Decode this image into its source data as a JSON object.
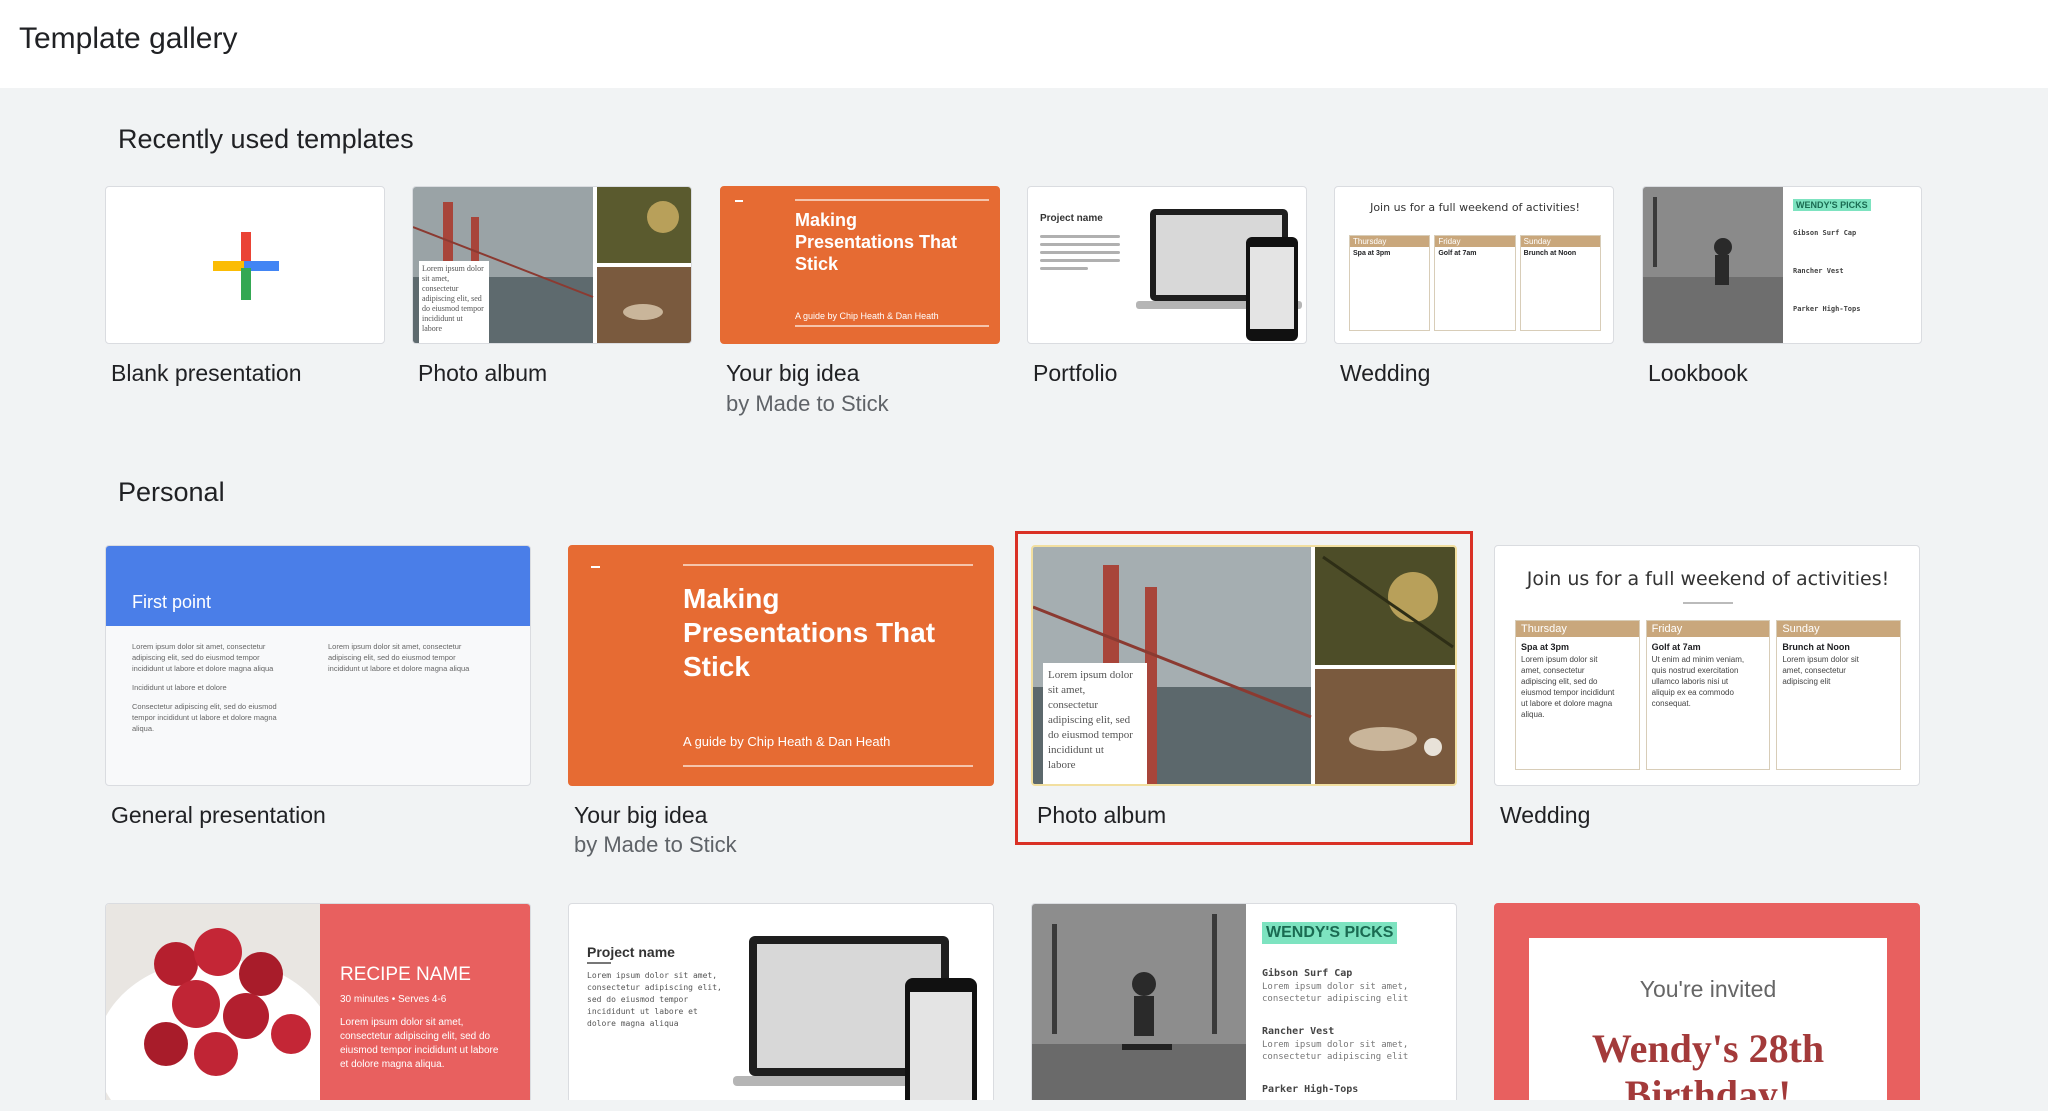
{
  "header": {
    "title": "Template gallery"
  },
  "sections": {
    "recent": {
      "title": "Recently used templates",
      "items": [
        {
          "name": "Blank presentation"
        },
        {
          "name": "Photo album",
          "caption_lines": [
            "Lorem ipsum dolor",
            "sit amet,",
            "consectetur",
            "adipiscing elit, sed",
            "do eiusmod tempor",
            "incididunt ut",
            "labore"
          ]
        },
        {
          "name": "Your big idea",
          "author": "by Made to Stick",
          "heading_lines": [
            "Making",
            "Presentations That",
            "Stick"
          ],
          "tagline": "A guide by Chip Heath & Dan Heath"
        },
        {
          "name": "Portfolio",
          "project": "Project name"
        },
        {
          "name": "Wedding",
          "headline": "Join us for a full weekend of activities!",
          "days": [
            "Thursday",
            "Friday",
            "Sunday"
          ],
          "events": [
            "Spa at 3pm",
            "Golf at 7am",
            "Brunch at Noon"
          ]
        },
        {
          "name": "Lookbook",
          "brand": "WENDY'S PICKS",
          "products": [
            "Gibson Surf Cap",
            "Rancher Vest",
            "Parker High-Tops"
          ]
        }
      ]
    },
    "personal": {
      "title": "Personal",
      "items": [
        {
          "name": "General presentation",
          "slide_title": "First point",
          "left_text": [
            "Lorem ipsum dolor sit amet, consectetur",
            "adipiscing elit, sed do eiusmod tempor",
            "incididunt ut labore et dolore magna aliqua",
            "Incididunt ut labore et dolore",
            "Consectetur adipiscing elit, sed do eiusmod",
            "tempor incididunt ut labore et dolore magna",
            "aliqua."
          ],
          "right_text": [
            "Lorem ipsum dolor sit amet, consectetur",
            "adipiscing elit, sed do eiusmod tempor",
            "incididunt ut labore et dolore magna aliqua"
          ]
        },
        {
          "name": "Your big idea",
          "author": "by Made to Stick",
          "heading_lines": [
            "Making",
            "Presentations That",
            "Stick"
          ],
          "tagline": "A guide by Chip Heath & Dan Heath"
        },
        {
          "name": "Photo album",
          "caption_lines": [
            "Lorem ipsum dolor",
            "sit amet,",
            "consectetur",
            "adipiscing elit, sed",
            "do eiusmod tempor",
            "incididunt ut",
            "labore"
          ]
        },
        {
          "name": "Wedding",
          "headline": "Join us for a full weekend of activities!",
          "days": [
            "Thursday",
            "Friday",
            "Sunday"
          ],
          "events": [
            "Spa at 3pm",
            "Golf at 7am",
            "Brunch at Noon"
          ],
          "day_text": [
            [
              "Lorem ipsum dolor sit",
              "amet, consectetur",
              "adipiscing elit, sed do",
              "eiusmod tempor incididunt",
              "ut labore et dolore magna",
              "aliqua."
            ],
            [
              "Ut enim ad minim veniam,",
              "quis nostrud exercitation",
              "ullamco laboris nisi ut",
              "aliquip ex ea commodo",
              "consequat."
            ],
            [
              "Lorem ipsum dolor sit",
              "amet, consectetur",
              "adipiscing elit"
            ]
          ]
        }
      ]
    },
    "more": {
      "items": [
        {
          "title": "RECIPE NAME",
          "meta": "30 minutes • Serves 4-6",
          "text": [
            "Lorem ipsum dolor sit amet,",
            "consectetur adipiscing elit, sed do",
            "eiusmod tempor incididunt ut labore",
            "et dolore magna aliqua."
          ]
        },
        {
          "project": "Project name",
          "text": [
            "Lorem ipsum dolor sit amet,",
            "consectetur adipiscing elit,",
            "sed do eiusmod tempor",
            "incididunt ut labore et",
            "dolore magna aliqua"
          ]
        },
        {
          "brand": "WENDY'S PICKS",
          "products": [
            "Gibson Surf Cap",
            "Rancher Vest",
            "Parker High-Tops"
          ],
          "lorem": "Lorem ipsum dolor sit amet,",
          "lorem2": "consectetur adipiscing elit"
        },
        {
          "invite": "You're invited",
          "event_lines": [
            "Wendy's 28th",
            "Birthday!"
          ]
        }
      ]
    }
  },
  "colors": {
    "orange": "#e66b33",
    "blue": "#4a7ee8",
    "red": "#d93025",
    "tan": "#c9a77c",
    "coral": "#e8605f",
    "wine": "#a33a3a"
  }
}
